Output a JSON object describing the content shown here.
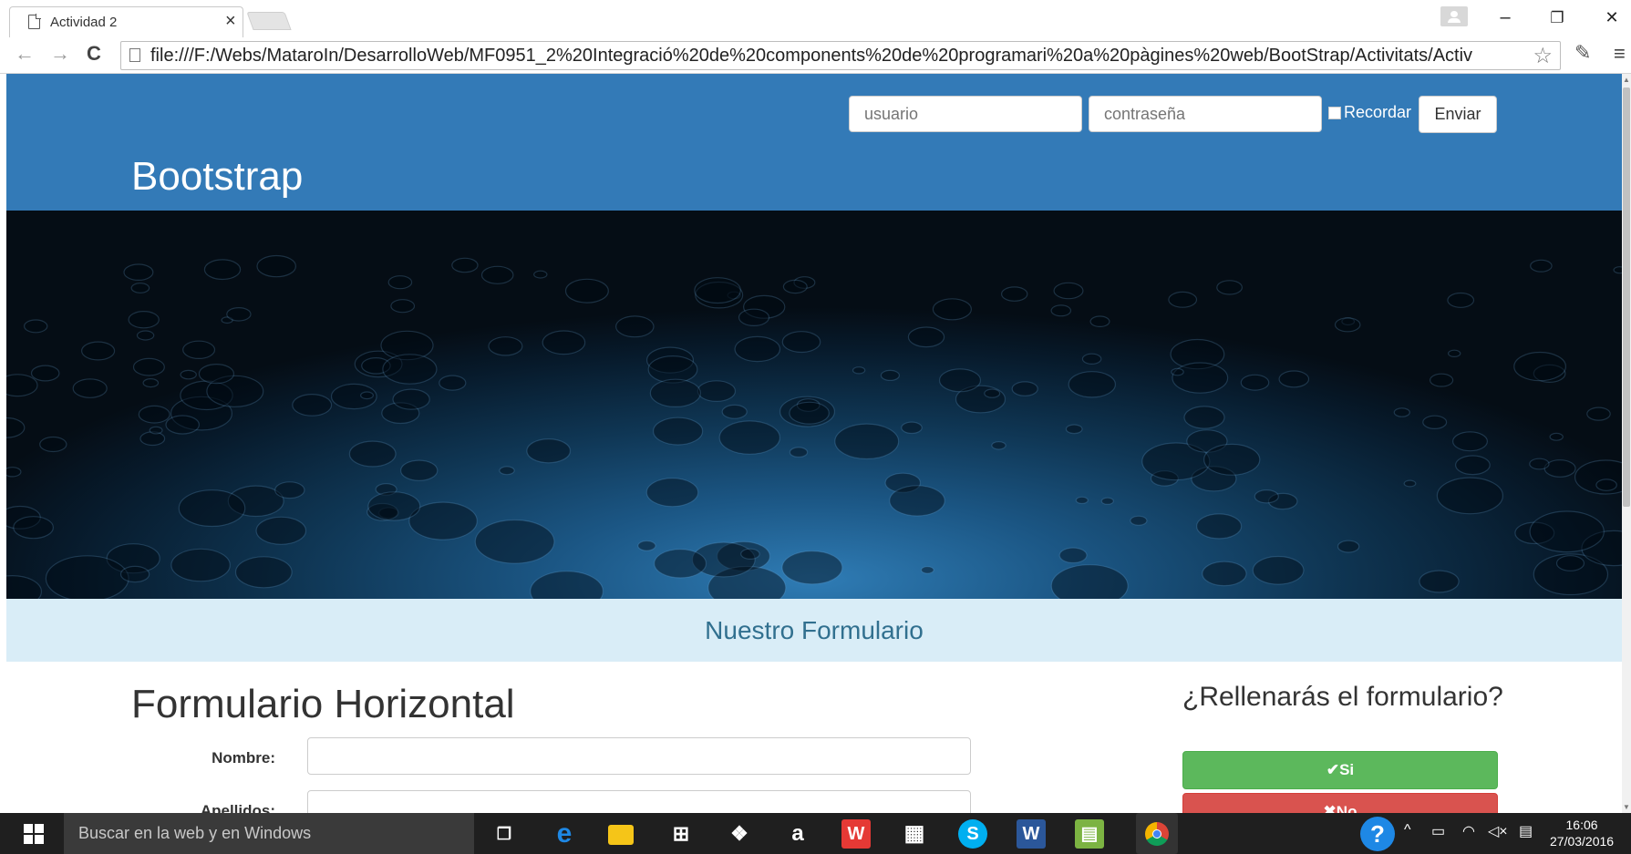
{
  "browser": {
    "tab_title": "Actividad 2",
    "tab_close": "×",
    "url": "file:///F:/Webs/MataroIn/DesarrolloWeb/MF0951_2%20Integració%20de%20components%20de%20programari%20a%20pàgines%20web/BootStrap/Activitats/Activ",
    "back_glyph": "←",
    "forward_glyph": "→",
    "reload_glyph": "C",
    "star_glyph": "☆",
    "menu_glyph": "≡",
    "minimize_glyph": "–",
    "maximize_glyph": "❐",
    "close_glyph": "✕"
  },
  "header": {
    "user_placeholder": "usuario",
    "password_placeholder": "contraseña",
    "remember_label": "Recordar",
    "send_label": "Enviar",
    "brand": "Bootstrap",
    "color": "#337ab7"
  },
  "band": {
    "title": "Nuestro Formulario",
    "color": "#d9edf7"
  },
  "form": {
    "title": "Formulario Horizontal",
    "fields": [
      {
        "label": "Nombre:"
      },
      {
        "label": "Apellidos:"
      }
    ]
  },
  "side": {
    "question": "¿Rellenarás el formulario?",
    "yes_label": "✔Si",
    "no_label": "✖No",
    "yes_color": "#5cb85c",
    "no_color": "#d9534f"
  },
  "taskbar": {
    "search_placeholder": "Buscar en la web y en Windows",
    "time": "16:06",
    "date": "27/03/2016",
    "icons": [
      "task-view-icon",
      "edge-icon",
      "file-explorer-icon",
      "store-icon",
      "dropbox-icon",
      "amazon-icon",
      "wps-icon",
      "calculator-icon",
      "skype-icon",
      "word-icon",
      "sheet-icon",
      "chrome-icon"
    ]
  }
}
